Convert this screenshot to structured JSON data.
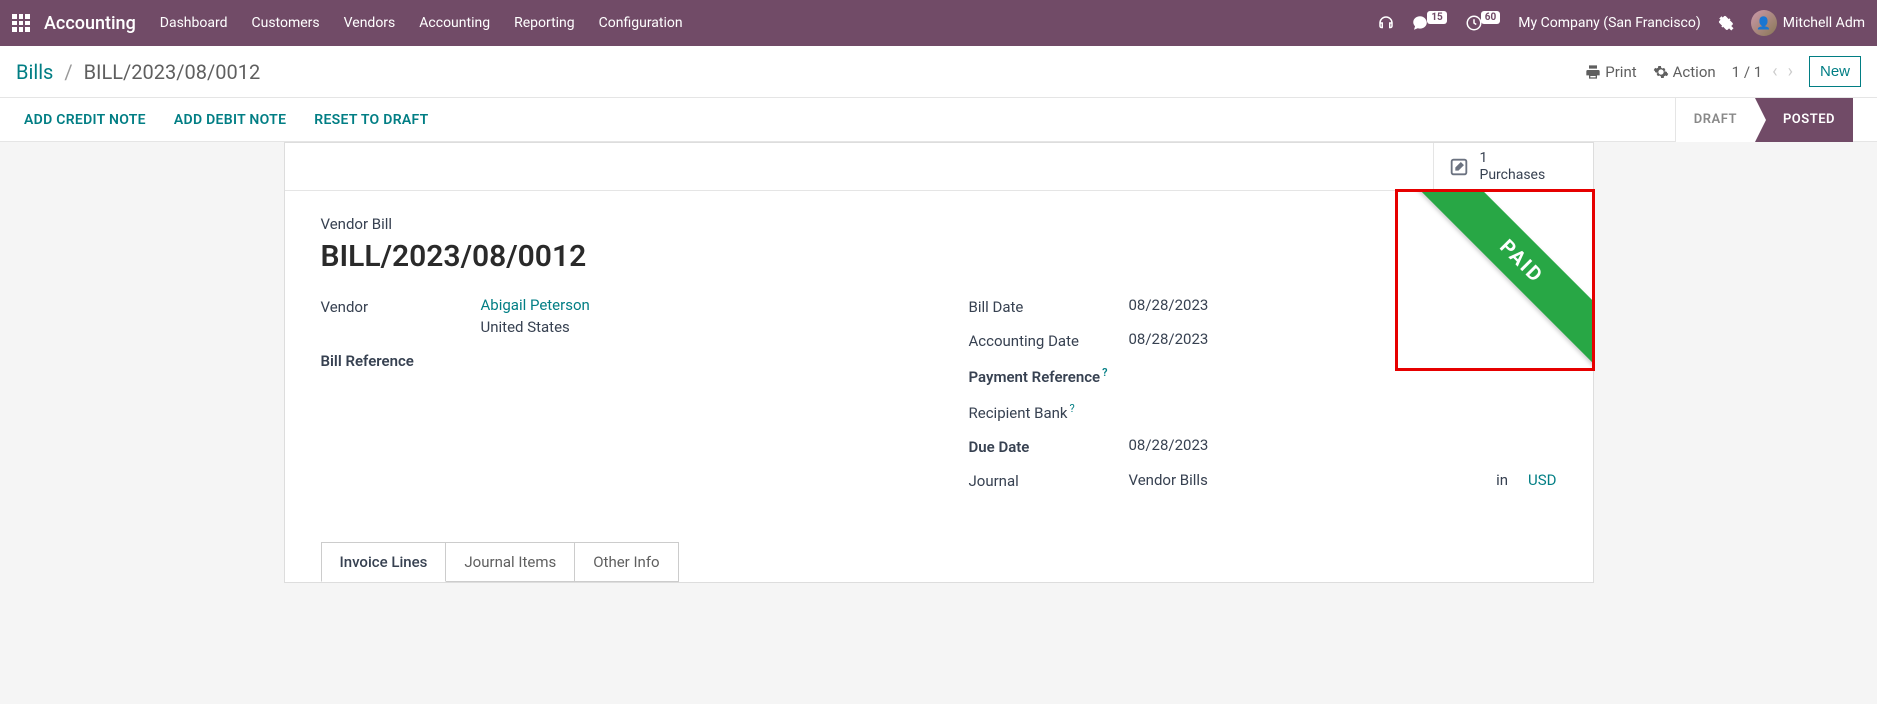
{
  "topnav": {
    "brand": "Accounting",
    "menu": [
      "Dashboard",
      "Customers",
      "Vendors",
      "Accounting",
      "Reporting",
      "Configuration"
    ],
    "msg_badge": "15",
    "clock_badge": "60",
    "company": "My Company (San Francisco)",
    "user": "Mitchell Adm"
  },
  "controlbar": {
    "root": "Bills",
    "current": "BILL/2023/08/0012",
    "print": "Print",
    "action": "Action",
    "pager": "1 / 1",
    "new": "New"
  },
  "actionbar": {
    "credit": "ADD CREDIT NOTE",
    "debit": "ADD DEBIT NOTE",
    "reset": "RESET TO DRAFT",
    "draft": "DRAFT",
    "posted": "POSTED"
  },
  "stat": {
    "count": "1",
    "label": "Purchases"
  },
  "ribbon": "PAID",
  "doc": {
    "type": "Vendor Bill",
    "title": "BILL/2023/08/0012"
  },
  "left": {
    "vendor_label": "Vendor",
    "vendor_name": "Abigail Peterson",
    "vendor_country": "United States",
    "billref_label": "Bill Reference"
  },
  "right": {
    "billdate_label": "Bill Date",
    "billdate": "08/28/2023",
    "accdate_label": "Accounting Date",
    "accdate": "08/28/2023",
    "payref_label": "Payment Reference",
    "recbank_label": "Recipient Bank",
    "duedate_label": "Due Date",
    "duedate": "08/28/2023",
    "journal_label": "Journal",
    "journal": "Vendor Bills",
    "in": "in",
    "currency": "USD"
  },
  "tabs": {
    "lines": "Invoice Lines",
    "items": "Journal Items",
    "other": "Other Info"
  }
}
